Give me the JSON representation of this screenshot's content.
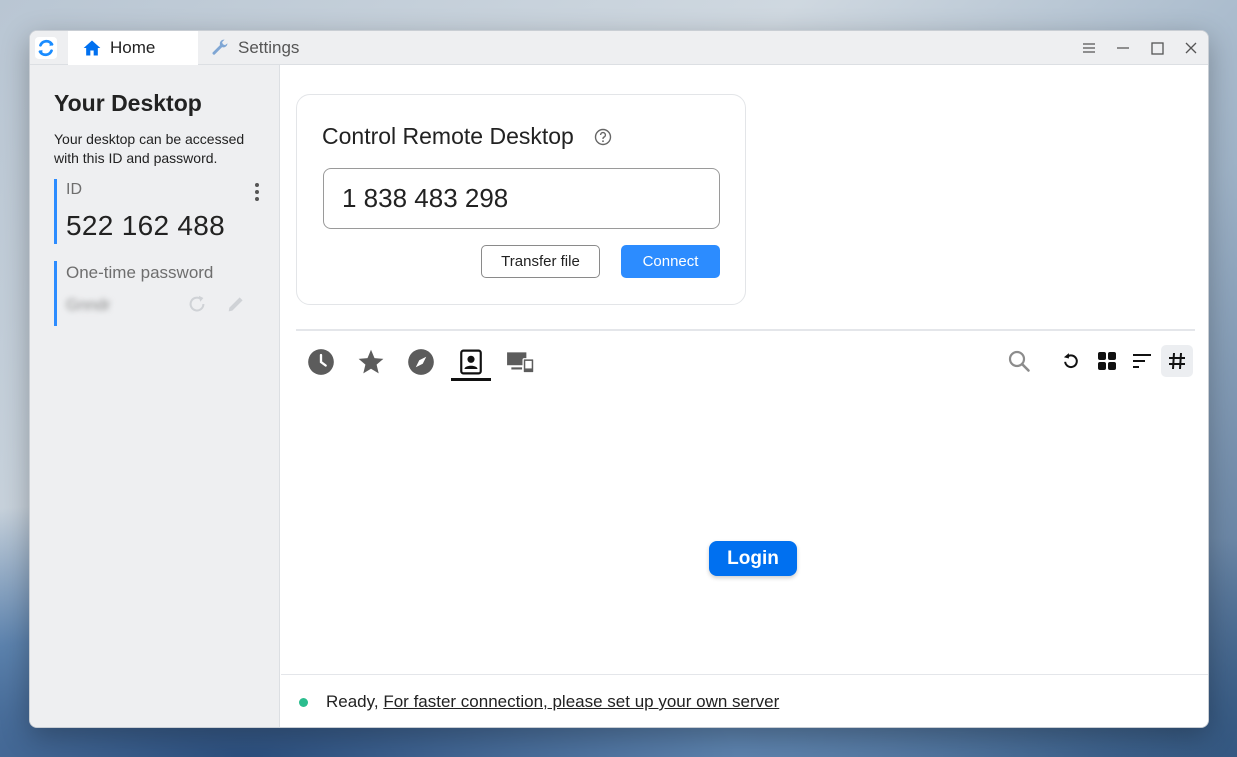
{
  "window": {
    "tabs": [
      {
        "label": "Home",
        "icon": "home-icon",
        "active": true
      },
      {
        "label": "Settings",
        "icon": "wrench-icon",
        "active": false
      }
    ]
  },
  "left_panel": {
    "title": "Your Desktop",
    "description": "Your desktop can be accessed with this ID and password.",
    "id_label": "ID",
    "id_value": "522 162 488",
    "password_label": "One-time password",
    "password_value": "Gnndr"
  },
  "control_card": {
    "title": "Control Remote Desktop",
    "remote_id_value": "1 838 483 298",
    "transfer_label": "Transfer file",
    "connect_label": "Connect"
  },
  "peer_tabs": [
    "recent-sessions",
    "favorites",
    "discovered",
    "address-book",
    "accessible-devices"
  ],
  "active_peer_tab": "address-book",
  "login_label": "Login",
  "status": {
    "state": "Ready,",
    "link_text": "For faster connection, please set up your own server",
    "color": "#2bbd8e"
  },
  "colors": {
    "accent": "#2c8cff",
    "login": "#0070f0"
  }
}
